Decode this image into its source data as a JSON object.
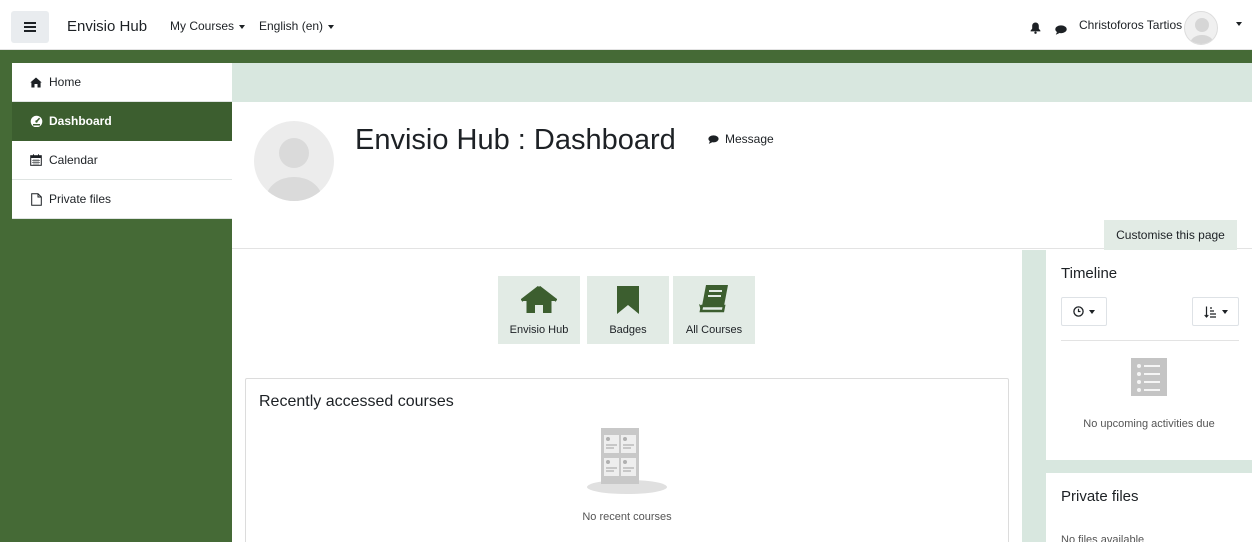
{
  "navbar": {
    "site_name": "Envisio Hub",
    "menu_my_courses": "My Courses",
    "menu_language": "English (en)",
    "user_name": "Christoforos Tartios",
    "icons": [
      "hamburger-icon",
      "bell-icon",
      "chat-icon",
      "user-avatar"
    ]
  },
  "sidebar": {
    "items": [
      {
        "label": "Home",
        "icon": "home-icon",
        "active": false
      },
      {
        "label": "Dashboard",
        "icon": "dashboard-icon",
        "active": true
      },
      {
        "label": "Calendar",
        "icon": "calendar-icon",
        "active": false
      },
      {
        "label": "Private files",
        "icon": "file-icon",
        "active": false
      }
    ]
  },
  "header": {
    "title": "Envisio Hub : Dashboard",
    "message_label": "Message",
    "customise_label": "Customise this page"
  },
  "quick_links": [
    {
      "label": "Envisio Hub",
      "icon": "home-icon"
    },
    {
      "label": "Badges",
      "icon": "bookmark-icon"
    },
    {
      "label": "All Courses",
      "icon": "book-icon"
    }
  ],
  "recent": {
    "title": "Recently accessed courses",
    "empty_text": "No recent courses"
  },
  "timeline": {
    "title": "Timeline",
    "empty_text": "No upcoming activities due"
  },
  "private_files": {
    "title": "Private files",
    "empty_text": "No files available"
  },
  "colors": {
    "brand_green": "#456a36",
    "active_green": "#3c5e2f",
    "light_green": "#d8e7df",
    "quick_tile": "#e2ebe5"
  }
}
